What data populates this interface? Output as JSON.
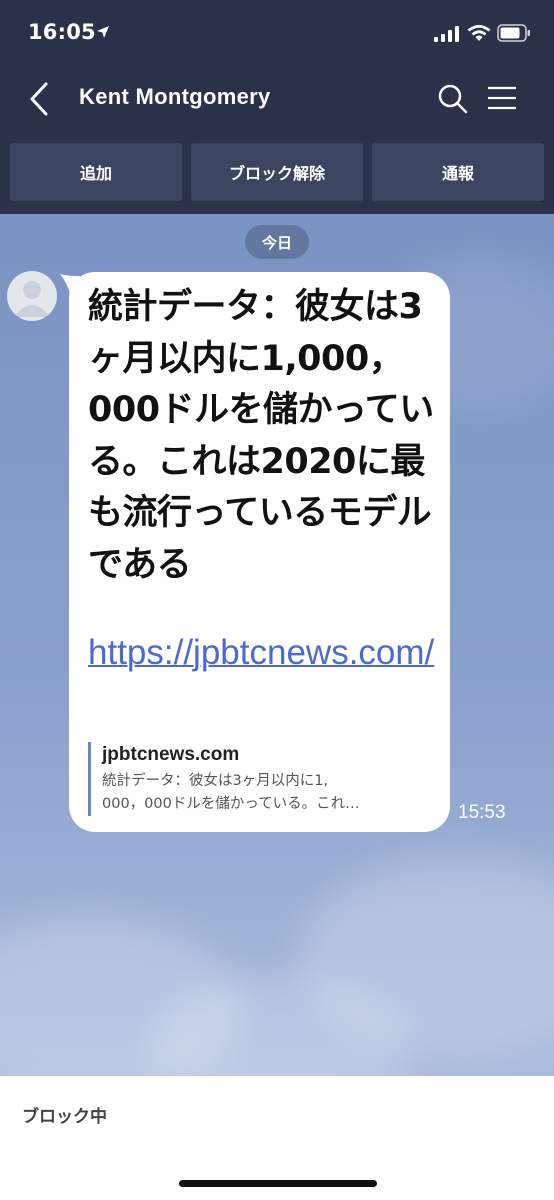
{
  "status_bar": {
    "time": "16:05",
    "icons": [
      "location-arrow-icon",
      "signal-icon",
      "wifi-icon",
      "battery-icon"
    ]
  },
  "header": {
    "title": "Kent Montgomery",
    "icons": [
      "back-icon",
      "search-icon",
      "menu-icon"
    ]
  },
  "actions": {
    "add": "追加",
    "unblock": "ブロック解除",
    "report": "通報"
  },
  "chat": {
    "date_label": "今日",
    "message": {
      "text": "統計データ：彼女は3ヶ月以内に1,000，000ドルを儲かっている。これは2020に最も流行っているモデルである",
      "link": "https://jpbtcnews.com/",
      "preview_domain": "jpbtcnews.com",
      "preview_desc_line1": "統計データ：彼女は3ヶ月以内に1,",
      "preview_desc_line2": "000，000ドルを儲かっている。これ…",
      "time": "15:53"
    }
  },
  "footer": {
    "status": "ブロック中"
  },
  "colors": {
    "header_bg": "#2a3149",
    "button_bg": "#3c4460",
    "link": "#4a6ad0",
    "chat_bg": "#8ba1cc"
  }
}
